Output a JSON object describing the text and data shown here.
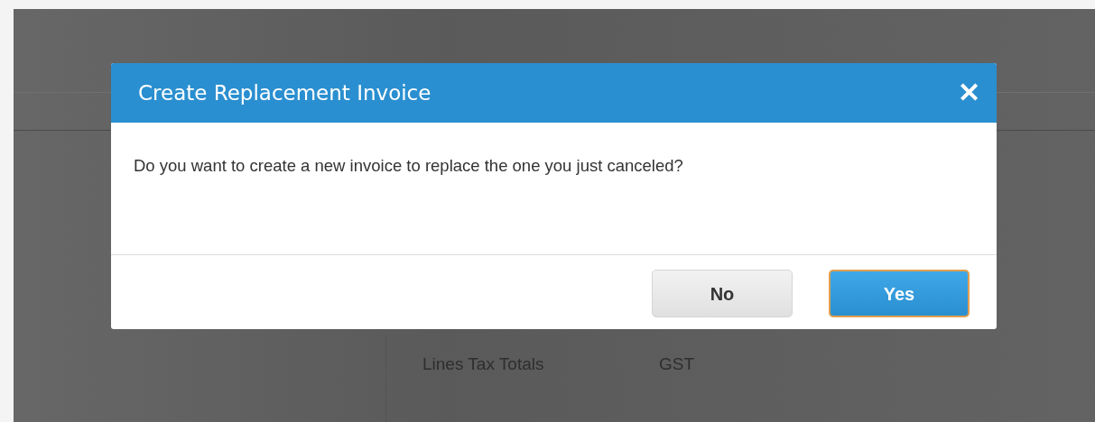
{
  "background": {
    "totals": [
      {
        "label": "Lines Tax Totals",
        "value": "GST"
      }
    ]
  },
  "dialog": {
    "title": "Create Replacement Invoice",
    "close": "✕",
    "message": "Do you want to create a new invoice to replace the one you just canceled?",
    "buttons": [
      {
        "label": "No",
        "kind": "secondary"
      },
      {
        "label": "Yes",
        "kind": "primary"
      }
    ]
  }
}
